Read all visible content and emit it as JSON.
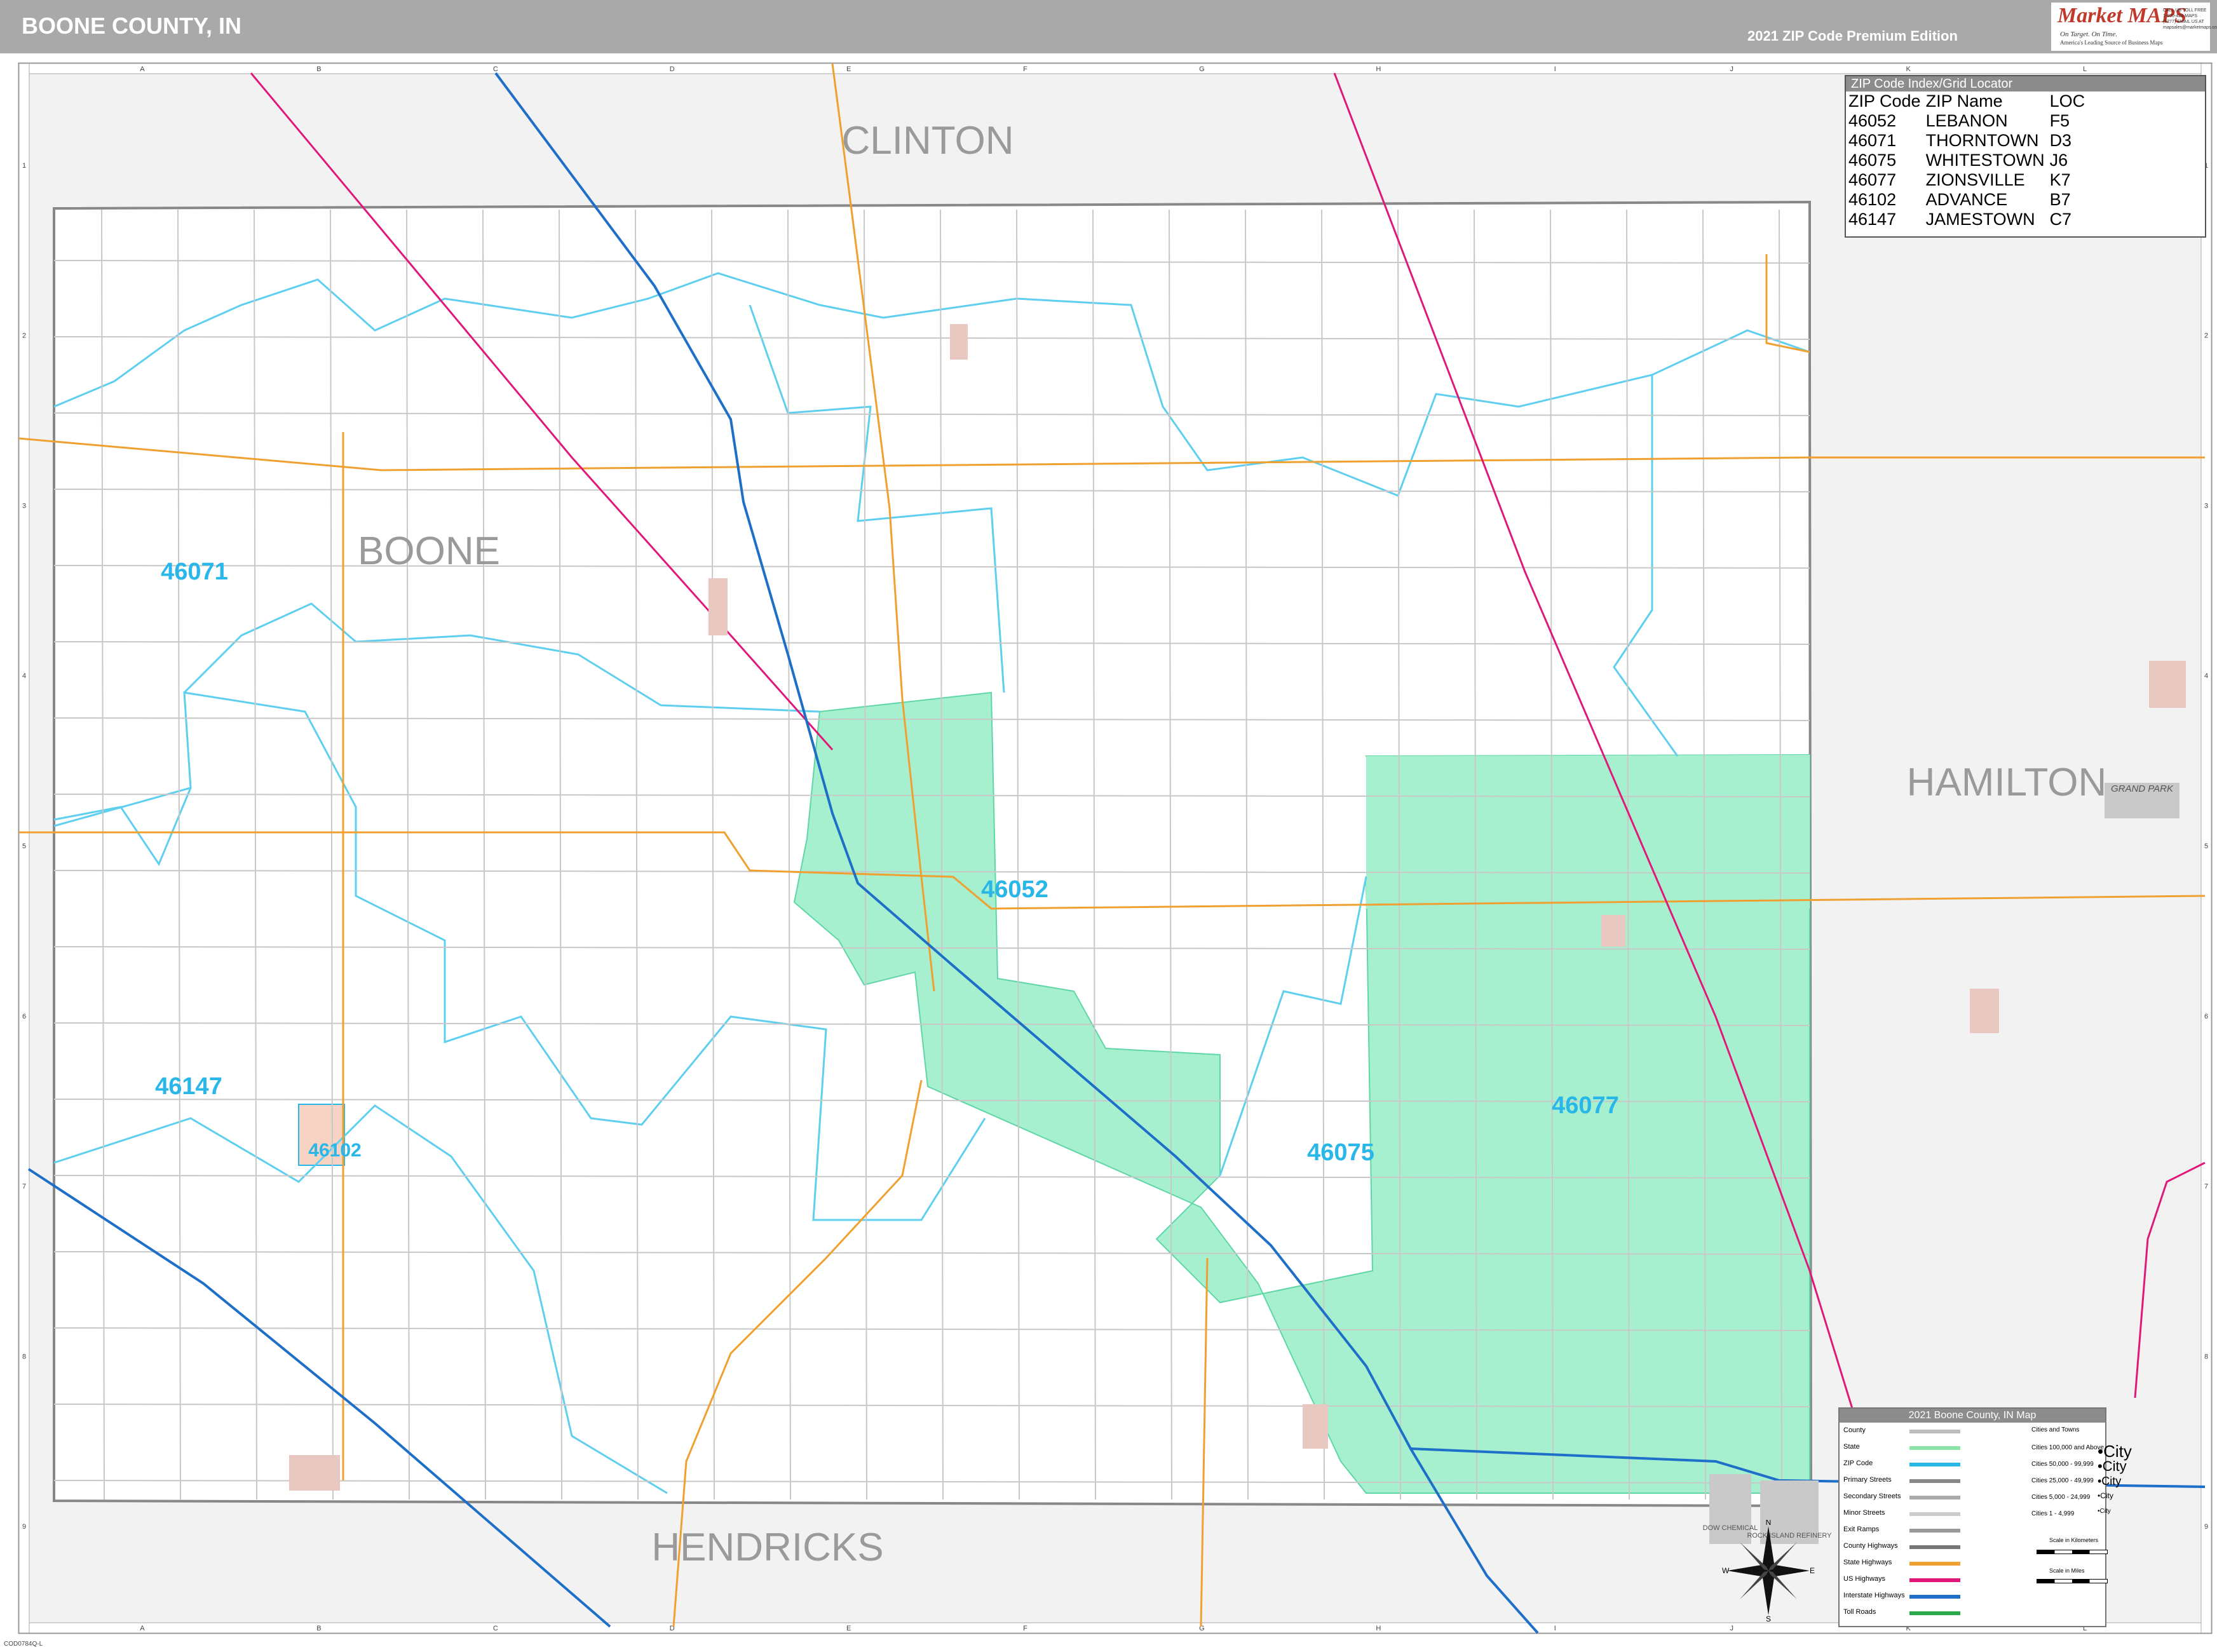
{
  "header": {
    "title": "BOONE COUNTY, IN",
    "edition": "2021 ZIP Code Premium Edition",
    "logo_text": "Market MAPS",
    "logo_tagline": "On Target. On Time.",
    "logo_subtag": "America's Leading Source of Business Maps",
    "logo_contact": "CALL US TOLL FREE 1-800-424-MAPS (6277) EMAIL US AT mapsales@marketmaps.com"
  },
  "grid": {
    "columns": [
      "A",
      "B",
      "C",
      "D",
      "E",
      "F",
      "G",
      "H",
      "I",
      "J",
      "K",
      "L"
    ],
    "rows": [
      "1",
      "2",
      "3",
      "4",
      "5",
      "6",
      "7",
      "8",
      "9"
    ]
  },
  "counties": {
    "boone": "BOONE",
    "clinton": "CLINTON",
    "hamilton": "HAMILTON",
    "hendricks": "HENDRICKS"
  },
  "zip_labels": [
    {
      "code": "46071",
      "color": "#29b6e8"
    },
    {
      "code": "46052",
      "color": "#29b6e8"
    },
    {
      "code": "46147",
      "color": "#29b6e8"
    },
    {
      "code": "46102",
      "color": "#29b6e8"
    },
    {
      "code": "46075",
      "color": "#29b6e8"
    },
    {
      "code": "46077",
      "color": "#29b6e8"
    }
  ],
  "places": {
    "grand_park": "GRAND PARK",
    "dow_chemical": "DOW CHEMICAL",
    "rock_island": "ROCK ISLAND REFINERY"
  },
  "zip_index": {
    "title": "ZIP Code Index/Grid Locator",
    "headers": [
      "ZIP Code",
      "ZIP Name",
      "LOC"
    ],
    "rows": [
      [
        "46052",
        "LEBANON",
        "F5"
      ],
      [
        "46071",
        "THORNTOWN",
        "D3"
      ],
      [
        "46075",
        "WHITESTOWN",
        "J6"
      ],
      [
        "46077",
        "ZIONSVILLE",
        "K7"
      ],
      [
        "46102",
        "ADVANCE",
        "B7"
      ],
      [
        "46147",
        "JAMESTOWN",
        "C7"
      ]
    ]
  },
  "legend": {
    "title": "2021 Boone County, IN Map",
    "items": [
      {
        "label": "County",
        "color": "#bdbdbd"
      },
      {
        "label": "State",
        "color": "#8be3a8"
      },
      {
        "label": "ZIP Code",
        "color": "#29b6e8"
      },
      {
        "label": "Primary Streets",
        "color": "#888888"
      },
      {
        "label": "Secondary Streets",
        "color": "#aaaaaa"
      },
      {
        "label": "Minor Streets",
        "color": "#cccccc"
      },
      {
        "label": "Exit Ramps",
        "color": "#999999"
      },
      {
        "label": "County Highways",
        "color": "#777777"
      },
      {
        "label": "State Highways",
        "color": "#f0a030"
      },
      {
        "label": "US Highways",
        "color": "#e0187a"
      },
      {
        "label": "Interstate Highways",
        "color": "#1e6fc8"
      },
      {
        "label": "Toll Roads",
        "color": "#2aa84a"
      }
    ],
    "cities_header": "Cities and Towns",
    "cities": [
      {
        "label": "Cities 100,000 and Above",
        "sample": "City"
      },
      {
        "label": "Cities 50,000 - 99,999",
        "sample": "City"
      },
      {
        "label": "Cities 25,000 - 49,999",
        "sample": "City"
      },
      {
        "label": "Cities 5,000 - 24,999",
        "sample": "City"
      },
      {
        "label": "Cities 1 - 4,999",
        "sample": "City"
      }
    ],
    "scale_km": "Scale in Kilometers",
    "scale_mi": "Scale in Miles"
  },
  "compass": {
    "n": "N",
    "s": "S",
    "e": "E",
    "w": "W"
  },
  "footer_code": "COD0784Q-L"
}
